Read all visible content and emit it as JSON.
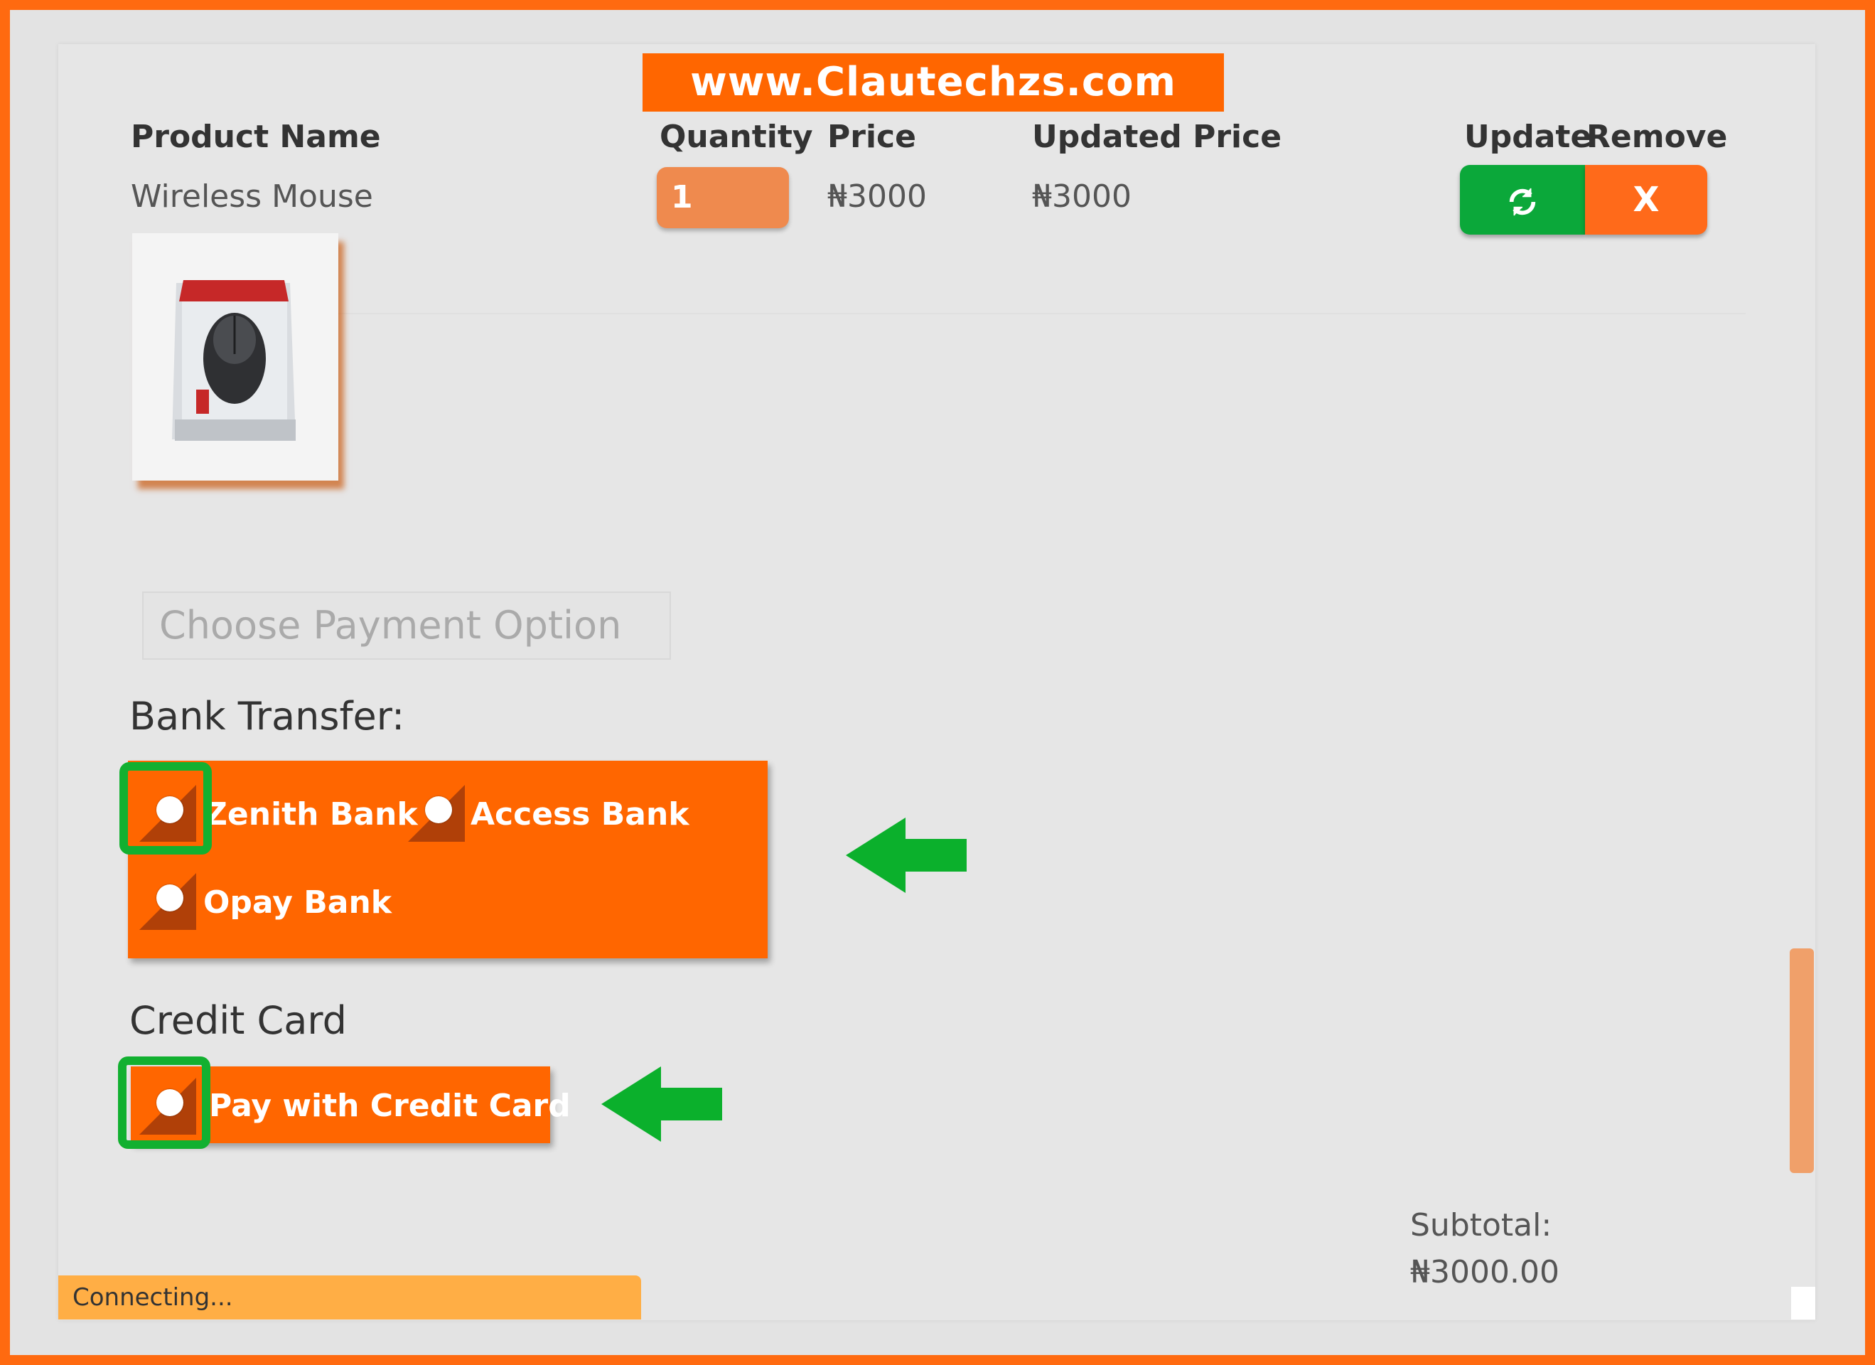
{
  "watermark": "www.Clautechzs.com",
  "table": {
    "headers": {
      "product_name": "Product Name",
      "quantity": "Quantity",
      "price": "Price",
      "updated_price": "Updated Price",
      "update": "Update",
      "remove": "Remove"
    },
    "row": {
      "product_name": "Wireless Mouse",
      "quantity": "1",
      "price": "₦3000",
      "updated_price": "₦3000",
      "update_icon": "refresh-icon",
      "remove_label": "X"
    }
  },
  "payment": {
    "heading_placeholder": "Choose Payment Option",
    "bank_transfer_title": "Bank Transfer:",
    "banks": [
      "Zenith Bank",
      "Access Bank",
      "Opay Bank"
    ],
    "credit_card_title": "Credit Card",
    "credit_card_option": "Pay with Credit Card"
  },
  "summary": {
    "subtotal_label": "Subtotal:",
    "subtotal_value": "₦3000.00"
  },
  "status_bar": "Connecting...",
  "colors": {
    "accent": "#ff6600",
    "update_green": "#0ba83a",
    "annotation_green": "#12b030"
  }
}
